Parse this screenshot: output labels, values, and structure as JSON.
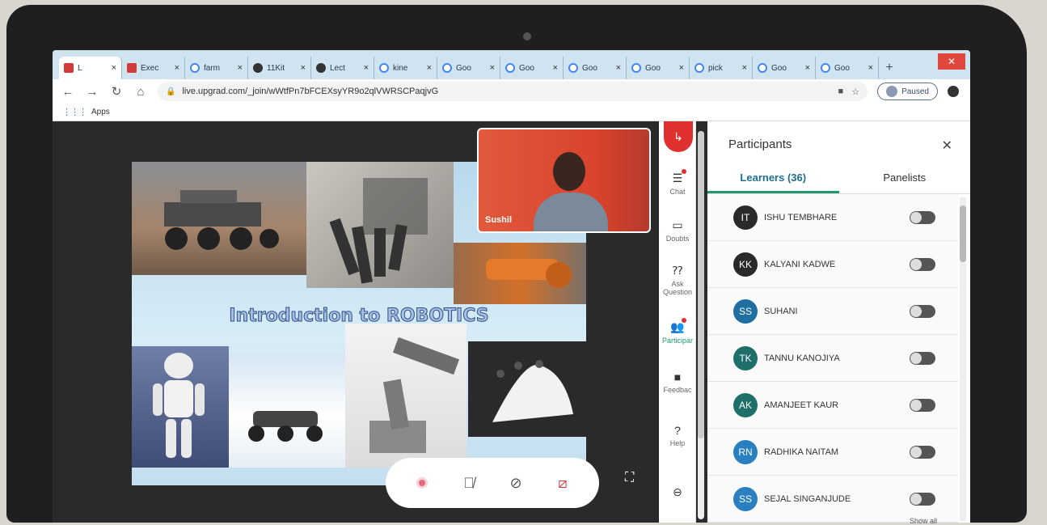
{
  "browser": {
    "tabs": [
      {
        "label": "L",
        "fav": "red"
      },
      {
        "label": "Exec",
        "fav": "red"
      },
      {
        "label": "farm",
        "fav": "g"
      },
      {
        "label": "11Kit",
        "fav": "dark"
      },
      {
        "label": "Lect",
        "fav": "dark"
      },
      {
        "label": "kine",
        "fav": "g"
      },
      {
        "label": "Goo",
        "fav": "g"
      },
      {
        "label": "Goo",
        "fav": "g"
      },
      {
        "label": "Goo",
        "fav": "g"
      },
      {
        "label": "Goo",
        "fav": "g"
      },
      {
        "label": "pick",
        "fav": "g"
      },
      {
        "label": "Goo",
        "fav": "g"
      },
      {
        "label": "Goo",
        "fav": "g"
      }
    ],
    "url": "live.upgrad.com/_join/wWtfPn7bFCEXsyYR9o2qlVWRSCPaqjvG",
    "profile_label": "Paused",
    "bookmarks_apps": "Apps"
  },
  "slide": {
    "title": "Introduction to ROBOTICS"
  },
  "video": {
    "name": "Sushil"
  },
  "rail": {
    "items": [
      {
        "label": "Chat",
        "icon": "chat-icon"
      },
      {
        "label": "Doubts",
        "icon": "doubts-icon"
      },
      {
        "label": "Ask Question",
        "icon": "question-icon"
      },
      {
        "label": "Participar",
        "icon": "participants-icon"
      },
      {
        "label": "Feedbac",
        "icon": "feedback-icon"
      },
      {
        "label": "Help",
        "icon": "help-icon"
      }
    ]
  },
  "panel": {
    "title": "Participants",
    "tabs": [
      "Learners (36)",
      "Panelists"
    ],
    "learners": [
      {
        "initials": "IT",
        "name": "ISHU TEMBHARE",
        "color": "#2a2a2a"
      },
      {
        "initials": "KK",
        "name": "KALYANI KADWE",
        "color": "#2a2a2a"
      },
      {
        "initials": "SS",
        "name": "SUHANI",
        "color": "#1f6fa0"
      },
      {
        "initials": "TK",
        "name": "TANNU KANOJIYA",
        "color": "#1e6f6a"
      },
      {
        "initials": "AK",
        "name": "AMANJEET KAUR",
        "color": "#1e6f6a"
      },
      {
        "initials": "RN",
        "name": "RADHIKA NAITAM",
        "color": "#2a7fc0"
      },
      {
        "initials": "SS",
        "name": "SEJAL SINGANJUDE",
        "color": "#2a7fc0"
      }
    ],
    "show_all": "Show all"
  }
}
